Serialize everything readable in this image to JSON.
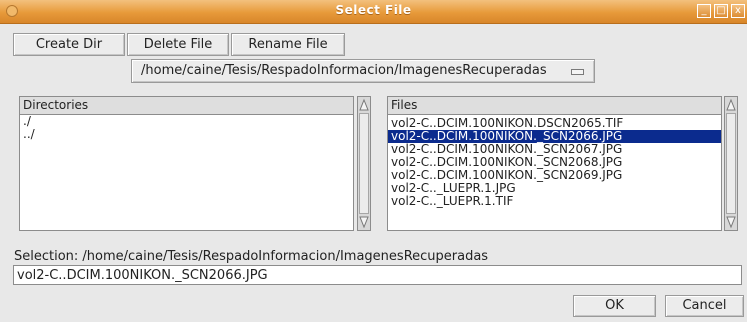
{
  "window": {
    "title": "Select File",
    "controls": {
      "minimize": "_",
      "maximize": "□",
      "close": "x"
    }
  },
  "toolbar": {
    "create_dir": "Create Dir",
    "delete_file": "Delete File",
    "rename_file": "Rename File"
  },
  "path": {
    "selected": "/home/caine/Tesis/RespadoInformacion/ImagenesRecuperadas"
  },
  "directories": {
    "header": "Directories",
    "items": [
      "./",
      "../"
    ]
  },
  "files": {
    "header": "Files",
    "items": [
      "vol2-C..DCIM.100NIKON.DSCN2065.TIF",
      "vol2-C..DCIM.100NIKON._SCN2066.JPG",
      "vol2-C..DCIM.100NIKON._SCN2067.JPG",
      "vol2-C..DCIM.100NIKON._SCN2068.JPG",
      "vol2-C..DCIM.100NIKON._SCN2069.JPG",
      "vol2-C.._LUEPR.1.JPG",
      "vol2-C.._LUEPR.1.TIF"
    ],
    "selected_index": 1
  },
  "selection": {
    "label": "Selection: /home/caine/Tesis/RespadoInformacion/ImagenesRecuperadas",
    "value": "vol2-C..DCIM.100NIKON._SCN2066.JPG"
  },
  "actions": {
    "ok": "OK",
    "cancel": "Cancel"
  },
  "colors": {
    "titlebar": "#e79a3a",
    "selection_bg": "#0b2b8e"
  }
}
